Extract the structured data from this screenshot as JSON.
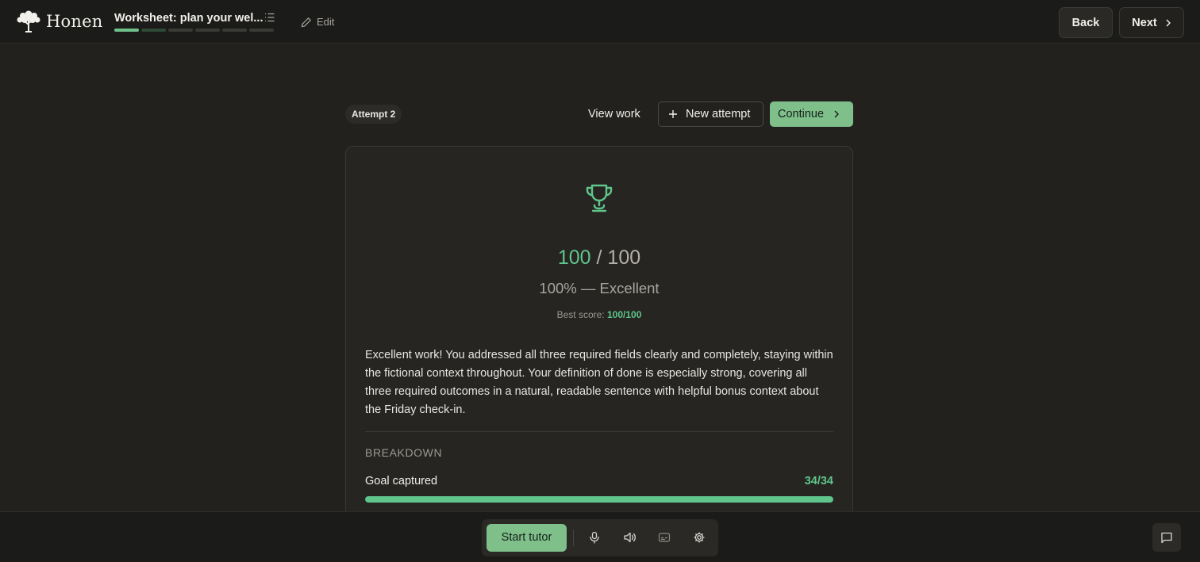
{
  "header": {
    "brand": "Honen",
    "lesson_title": "Worksheet: plan your wel...",
    "edit_label": "Edit",
    "back_label": "Back",
    "next_label": "Next",
    "progress_segments": [
      "done",
      "partial",
      "todo",
      "todo",
      "todo",
      "todo"
    ]
  },
  "actions": {
    "attempt_label": "Attempt 2",
    "view_work_label": "View work",
    "new_attempt_label": "New attempt",
    "continue_label": "Continue"
  },
  "result": {
    "score": "100",
    "separator": "/",
    "total": "100",
    "grade": "100% — Excellent",
    "best_score_label": "Best score:",
    "best_score_value": "100/100",
    "feedback": "Excellent work! You addressed all three required fields clearly and completely, staying within the fictional context throughout. Your definition of done is especially strong, covering all three required outcomes in a natural, readable sentence with helpful bonus context about the Friday check-in.",
    "breakdown_heading": "BREAKDOWN",
    "criteria": [
      {
        "label": "Goal captured",
        "score": "34/34",
        "fraction": 1.0
      }
    ]
  },
  "footer": {
    "start_tutor_label": "Start tutor",
    "icons": [
      "microphone-icon",
      "speaker-icon",
      "captions-icon",
      "gear-icon",
      "chat-icon"
    ]
  },
  "colors": {
    "accent_green": "#5fc58a",
    "button_green": "#7fbf8a",
    "background": "#22211e"
  }
}
